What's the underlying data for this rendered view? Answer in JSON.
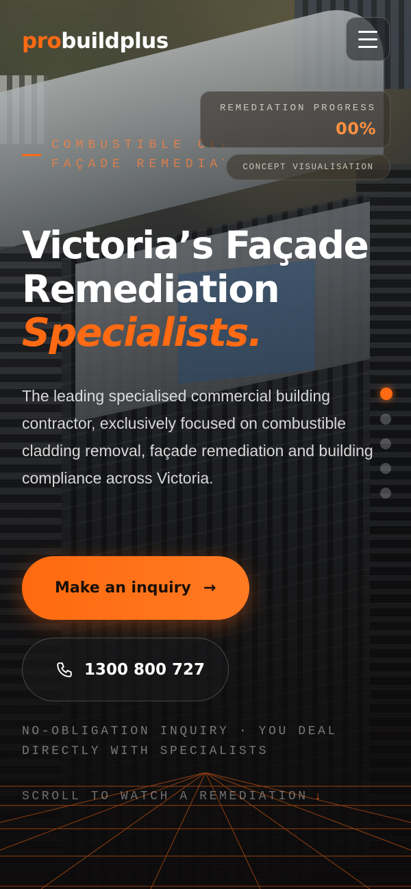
{
  "header": {
    "logo_accent": "pro",
    "logo_rest": "buildplus"
  },
  "progress": {
    "label": "REMEDIATION PROGRESS",
    "value": "00%",
    "fraction": 0,
    "concept_label": "CONCEPT VISUALISATION"
  },
  "eyebrow": {
    "line1": "COMBUSTIBLE CLADDING",
    "line2": "FAÇADE REMEDIATION"
  },
  "hero": {
    "title_line1": "Victoria’s Façade",
    "title_line2": "Remediation",
    "title_accent": "Specialists.",
    "lead": "The leading specialised commercial building contractor, exclusively focused on combustible cladding removal, façade remediation and building compliance across Victoria."
  },
  "section_dots": {
    "count": 5,
    "active_index": 0
  },
  "cta": {
    "primary_label": "Make an inquiry",
    "primary_arrow": "→",
    "phone_number": "1300 800 727"
  },
  "note": "NO-OBLIGATION INQUIRY · YOU DEAL DIRECTLY WITH SPECIALISTS",
  "scroll_hint": "SCROLL TO WATCH A REMEDIATION",
  "scroll_arrow": "↓",
  "colors": {
    "accent": "#ff6a13",
    "background": "#0d0b0a"
  },
  "icons": {
    "menu": "hamburger-icon",
    "phone": "phone-icon",
    "arrow": "arrow-right-icon",
    "scroll": "arrow-down-icon"
  }
}
